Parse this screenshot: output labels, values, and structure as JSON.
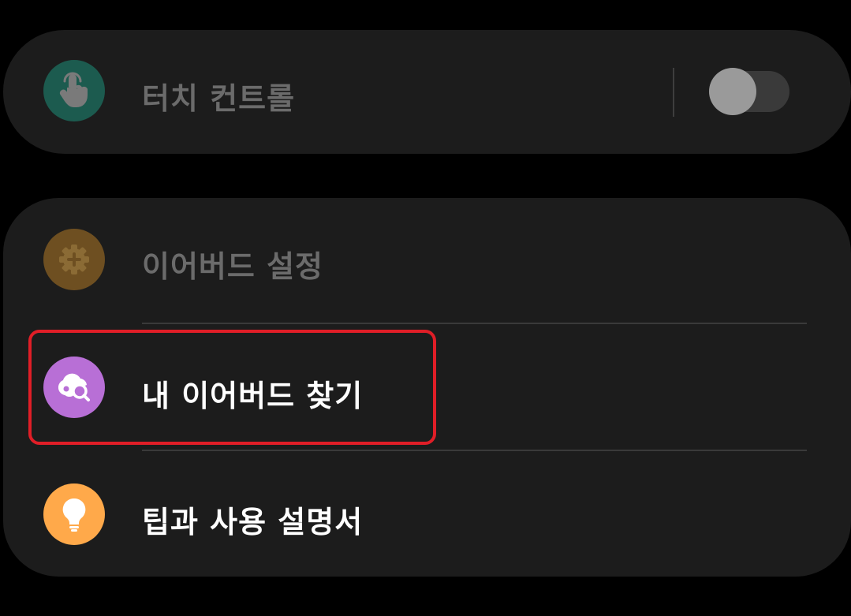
{
  "touch_control": {
    "label": "터치 컨트롤",
    "icon": "touch-hand-icon",
    "icon_color": "#1c5b4f",
    "toggle_on": false
  },
  "menu": {
    "items": [
      {
        "label": "이어버드 설정",
        "icon": "gear-plus-icon",
        "icon_color": "#6e4f21",
        "enabled": false
      },
      {
        "label": "내 이어버드 찾기",
        "icon": "find-earbuds-icon",
        "icon_color": "#b86fd6",
        "enabled": true,
        "highlighted": true
      },
      {
        "label": "팁과 사용 설명서",
        "icon": "lightbulb-icon",
        "icon_color": "#ffa94a",
        "enabled": true
      }
    ]
  },
  "colors": {
    "background": "#000000",
    "card": "#1c1c1c",
    "highlight_border": "#e01e27"
  }
}
